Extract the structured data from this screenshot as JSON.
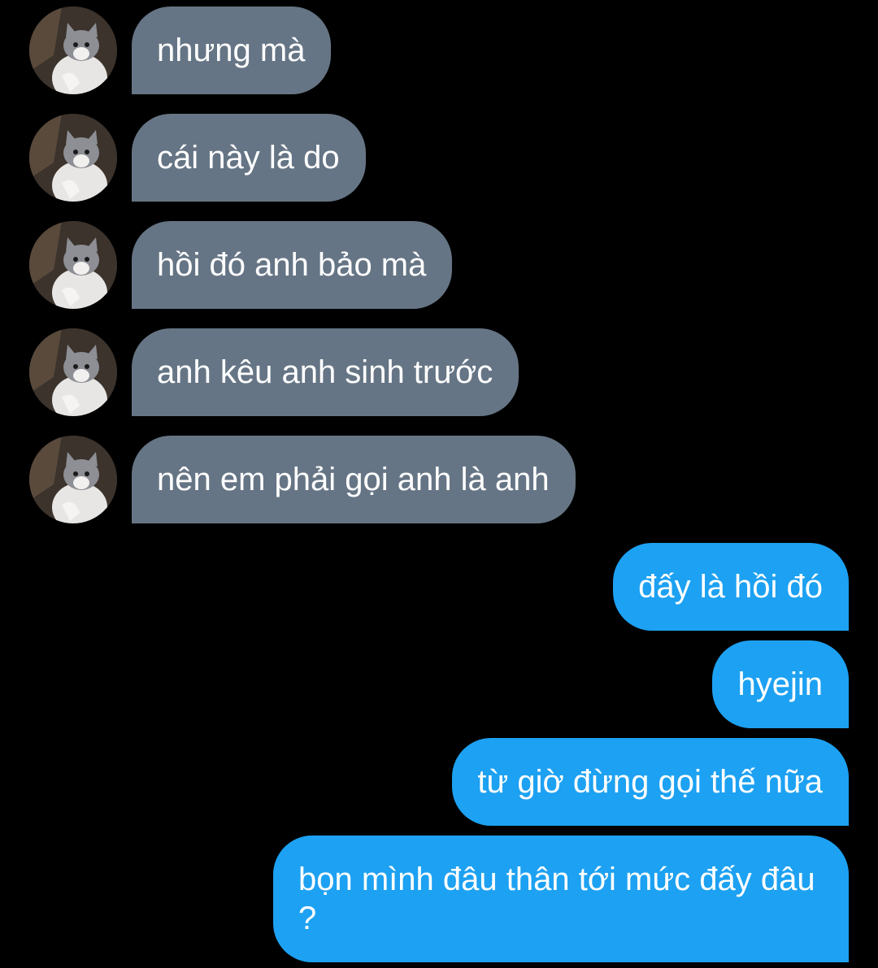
{
  "conversation": {
    "incoming": [
      {
        "text": "nhưng mà"
      },
      {
        "text": "cái này là do"
      },
      {
        "text": "hồi đó anh bảo mà"
      },
      {
        "text": "anh kêu anh sinh trước"
      },
      {
        "text": "nên em phải gọi anh là anh"
      }
    ],
    "outgoing": [
      {
        "text": "đấy là hồi đó"
      },
      {
        "text": "hyejin"
      },
      {
        "text": "từ giờ đừng gọi thế nữa"
      },
      {
        "text": "bọn mình đâu thân tới mức đấy đâu ?"
      }
    ]
  },
  "colors": {
    "background": "#000000",
    "incoming_bubble": "#667585",
    "outgoing_bubble": "#1da1f2",
    "text": "#ffffff"
  },
  "icons": {
    "avatar": "kitten-avatar"
  }
}
